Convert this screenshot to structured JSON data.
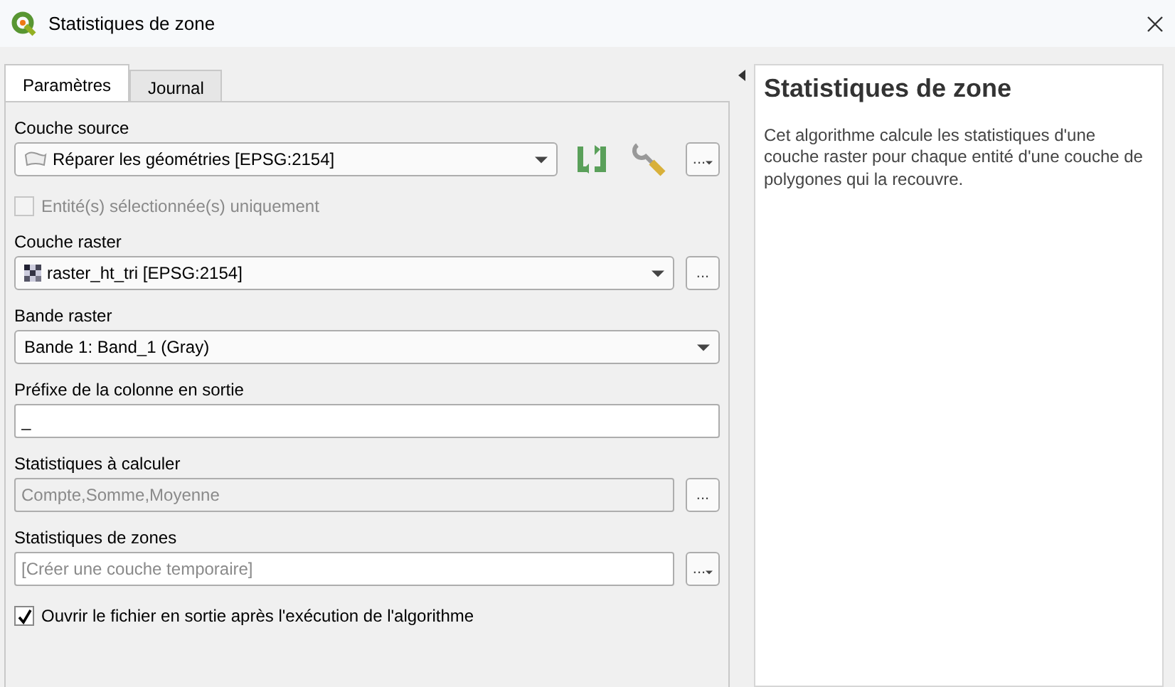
{
  "window": {
    "title": "Statistiques de zone"
  },
  "tabs": [
    {
      "label": "Paramètres",
      "selected": true
    },
    {
      "label": "Journal",
      "selected": false
    }
  ],
  "rows": [
    {
      "kind": "label",
      "text": "Couche source"
    },
    {
      "kind": "combo",
      "value": "Réparer les géométries [EPSG:2154]",
      "layer": {
        "kind": "vector"
      },
      "tools": true,
      "button": "...",
      "button_menu": true
    },
    {
      "kind": "checkbox",
      "text": "Entité(s) sélectionnée(s) uniquement",
      "checked": false,
      "disabled": true
    },
    {
      "kind": "label",
      "text": "Couche raster"
    },
    {
      "kind": "combo",
      "value": "raster_ht_tri [EPSG:2154]",
      "layer": {
        "kind": "raster"
      },
      "button": "...",
      "button_menu": false
    },
    {
      "kind": "label",
      "text": "Bande raster"
    },
    {
      "kind": "combo",
      "value": "Bande 1: Band_1 (Gray)"
    },
    {
      "kind": "label",
      "text": "Préfixe de la colonne en sortie"
    },
    {
      "kind": "field",
      "value": "_",
      "disabled": false
    },
    {
      "kind": "label",
      "text": "Statistiques à calculer"
    },
    {
      "kind": "field",
      "value": "Compte,Somme,Moyenne",
      "disabled": true,
      "button": "...",
      "button_menu": false
    },
    {
      "kind": "label",
      "text": "Statistiques de zones"
    },
    {
      "kind": "field",
      "placeholder": "[Créer une couche temporaire]",
      "disabled": false,
      "button": "...",
      "button_menu": true
    },
    {
      "kind": "checkbox",
      "text": "Ouvrir le fichier en sortie après l'exécution de l'algorithme",
      "checked": true,
      "disabled": false
    }
  ],
  "help": {
    "title": "Statistiques de zone",
    "text": "Cet algorithme calcule les statistiques d'une couche raster pour chaque entité d'une couche de polygones qui la recouvre."
  }
}
